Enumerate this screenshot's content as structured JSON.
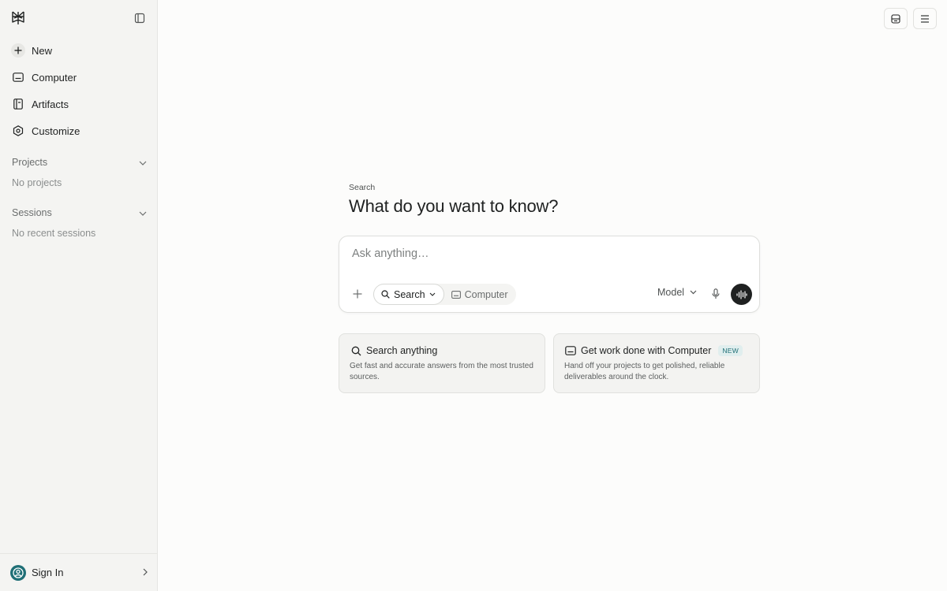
{
  "sidebar": {
    "items": [
      {
        "label": "New",
        "icon": "plus-icon"
      },
      {
        "label": "Computer",
        "icon": "computer-icon"
      },
      {
        "label": "Artifacts",
        "icon": "artifacts-icon"
      },
      {
        "label": "Customize",
        "icon": "customize-icon"
      }
    ],
    "projects": {
      "title": "Projects",
      "empty": "No projects"
    },
    "sessions": {
      "title": "Sessions",
      "empty": "No recent sessions"
    },
    "signin": "Sign In"
  },
  "main": {
    "eyebrow": "Search",
    "headline": "What do you want to know?",
    "composer": {
      "placeholder": "Ask anything…",
      "mode_search": "Search",
      "mode_computer": "Computer",
      "model": "Model"
    },
    "cards": [
      {
        "title": "Search anything",
        "desc": "Get fast and accurate answers from the most trusted sources."
      },
      {
        "title": "Get work done with Computer",
        "badge": "NEW",
        "desc": "Hand off your projects to get polished, reliable deliverables around the clock."
      }
    ]
  },
  "colors": {
    "accent": "#1f6f76",
    "sidebar_bg": "#f4f4f2",
    "page_bg": "#fcfcfb",
    "text": "#1f2121"
  }
}
